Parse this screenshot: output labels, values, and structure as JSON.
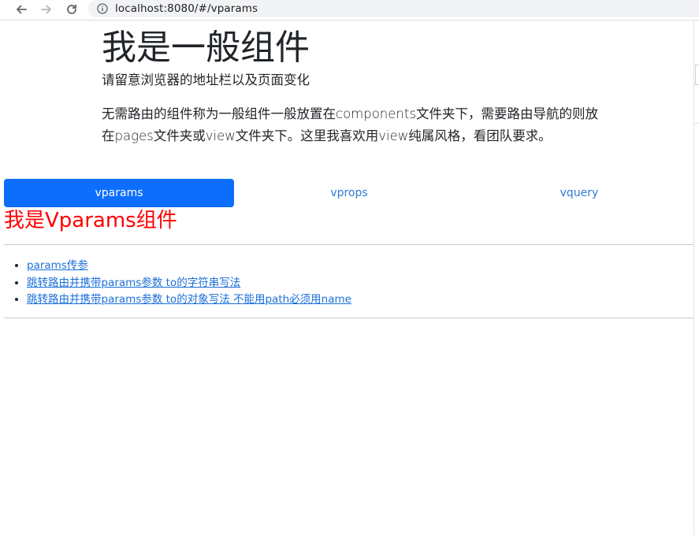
{
  "browser": {
    "url": "localhost:8080/#/vparams"
  },
  "header": {
    "title": "我是一般组件",
    "lead": "请留意浏览器的地址栏以及页面变化",
    "description": "无需路由的组件称为一般组件一般放置在components文件夹下，需要路由导航的则放在pages文件夹或view文件夹下。这里我喜欢用view纯属风格，看团队要求。"
  },
  "nav": {
    "items": [
      {
        "label": "vparams",
        "active": true
      },
      {
        "label": "vprops",
        "active": false
      },
      {
        "label": "vquery",
        "active": false
      }
    ]
  },
  "component": {
    "title": "我是Vparams组件",
    "title_color": "#ff0000"
  },
  "links": [
    {
      "label": "params传参"
    },
    {
      "label": "跳转路由并携带params参数 to的字符串写法"
    },
    {
      "label": "跳转路由并携带params参数 to的对象写法 不能用path必须用name"
    }
  ],
  "colors": {
    "active_pill": "#0d6efd",
    "link": "#1a6fd8"
  }
}
